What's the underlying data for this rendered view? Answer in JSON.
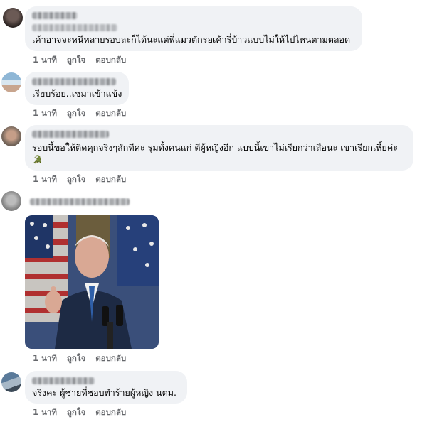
{
  "comments": [
    {
      "text": "เค้าอาจจะหนีหลายรอบละก็ได้นะแต่พี่แมวตักรอเค้ารี่บ้าวแบบไม่ให้ไปไหนตามตลอด",
      "time": "1 นาที",
      "like": "ถูกใจ",
      "reply": "ตอบกลับ"
    },
    {
      "text": "เรียบร้อย..เซมาเข้าแข้ง",
      "time": "1 นาที",
      "like": "ถูกใจ",
      "reply": "ตอบกลับ"
    },
    {
      "text": "รอบนี้ขอให้ติดคุกจริงๆสักทีค่ะ รุมทั้งคนแก่ ตีผู้หญิงอีก แบบนี้เขาไม่เรียกว่าเสือนะ เขาเรียกเหี้ยค่ะ",
      "emoji": "🐊",
      "time": "1 นาที",
      "like": "ถูกใจ",
      "reply": "ตอบกลับ"
    },
    {
      "time": "1 นาที",
      "like": "ถูกใจ",
      "reply": "ตอบกลับ"
    },
    {
      "text": "จริงคะ ผู้ชายที่ชอบทำร้ายผู้หญิง นตม.",
      "time": "1 นาที",
      "like": "ถูกใจ",
      "reply": "ตอบกลับ"
    }
  ]
}
